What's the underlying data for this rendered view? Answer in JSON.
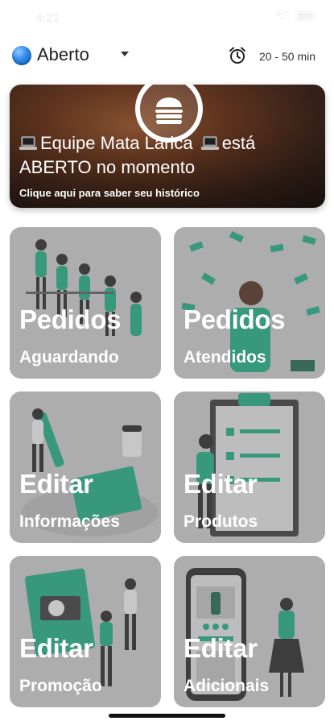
{
  "status_bar": {
    "time": "4:21"
  },
  "header": {
    "status_label": "Aberto",
    "time_range": "20 - 50 min"
  },
  "banner": {
    "team_name": "Equipe Mata Larica",
    "status_text": "está ABERTO no momento",
    "subtitle": "Clique aqui para saber seu histórico"
  },
  "cards": [
    {
      "title": "Pedidos",
      "subtitle": "Aguardando"
    },
    {
      "title": "Pedidos",
      "subtitle": "Atendidos"
    },
    {
      "title": "Editar",
      "subtitle": "Informações"
    },
    {
      "title": "Editar",
      "subtitle": "Produtos"
    },
    {
      "title": "Editar",
      "subtitle": "Promoção"
    },
    {
      "title": "Editar",
      "subtitle": "Adicionais"
    }
  ],
  "colors": {
    "accent": "#2bb08a",
    "status_dot": "#2f88e8",
    "card_bg": "#c9c9c9"
  }
}
